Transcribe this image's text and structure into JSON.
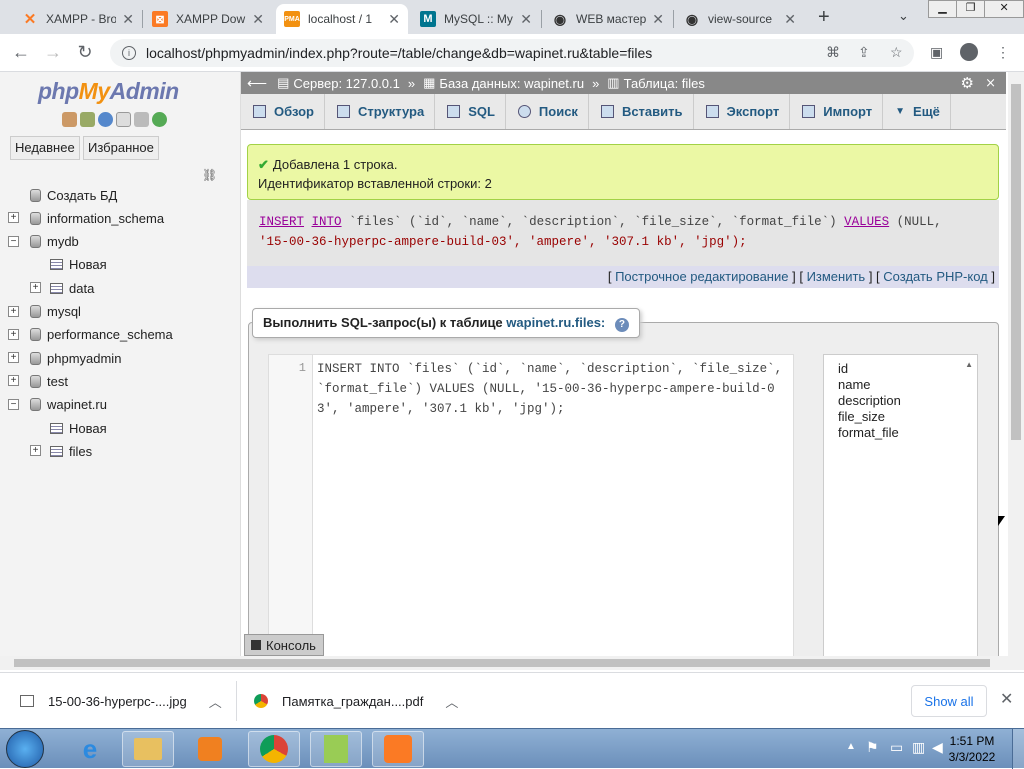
{
  "browser": {
    "tabs": [
      {
        "title": "XAMPP - Bro",
        "icon": "xampp-icon",
        "color": "#fb7a24"
      },
      {
        "title": "XAMPP Dow",
        "icon": "xampp-icon",
        "color": "#fb7a24"
      },
      {
        "title": "localhost / 1",
        "icon": "phpmyadmin-icon",
        "color": "#f29111"
      },
      {
        "title": "MySQL :: My",
        "icon": "mysql-icon",
        "color": "#00758f"
      },
      {
        "title": "WEB мастер",
        "icon": "eye-icon",
        "color": "#333333"
      },
      {
        "title": "view-source",
        "icon": "eye-icon",
        "color": "#333333"
      }
    ],
    "url": "localhost/phpmyadmin/index.php?route=/table/change&db=wapinet.ru&table=files"
  },
  "sidebar": {
    "logo": {
      "php": "php",
      "my": "My",
      "admin": "Admin"
    },
    "tabs": [
      "Недавнее",
      "Избранное"
    ],
    "tree": [
      {
        "label": "Создать БД",
        "level": 0,
        "expander": "",
        "icon": "db"
      },
      {
        "label": "information_schema",
        "level": 0,
        "expander": "+",
        "icon": "db"
      },
      {
        "label": "mydb",
        "level": 0,
        "expander": "−",
        "icon": "db"
      },
      {
        "label": "Новая",
        "level": 1,
        "expander": "",
        "icon": "tbl"
      },
      {
        "label": "data",
        "level": 1,
        "expander": "+",
        "icon": "tbl"
      },
      {
        "label": "mysql",
        "level": 0,
        "expander": "+",
        "icon": "db"
      },
      {
        "label": "performance_schema",
        "level": 0,
        "expander": "+",
        "icon": "db"
      },
      {
        "label": "phpmyadmin",
        "level": 0,
        "expander": "+",
        "icon": "db"
      },
      {
        "label": "test",
        "level": 0,
        "expander": "+",
        "icon": "db"
      },
      {
        "label": "wapinet.ru",
        "level": 0,
        "expander": "−",
        "icon": "db"
      },
      {
        "label": "Новая",
        "level": 1,
        "expander": "",
        "icon": "tbl"
      },
      {
        "label": "files",
        "level": 1,
        "expander": "+",
        "icon": "tbl"
      }
    ]
  },
  "breadcrumb": {
    "server": "Сервер: 127.0.0.1",
    "database": "База данных: wapinet.ru",
    "table": "Таблица: files"
  },
  "menu": [
    "Обзор",
    "Структура",
    "SQL",
    "Поиск",
    "Вставить",
    "Экспорт",
    "Импорт",
    "Ещё"
  ],
  "message": {
    "line1": "Добавлена 1 строка.",
    "line2": "Идентификатор вставленной строки: 2"
  },
  "query": {
    "kw1": "INSERT",
    "kw2": "INTO",
    "part1": " `files` (`id`, `name`, `description`, `file_size`, `format_file`) ",
    "kw3": "VALUES",
    "part2": " (NULL,",
    "line2": "'15-00-36-hyperpc-ampere-build-03', 'ampere', '307.1 kb', 'jpg');"
  },
  "query_links": {
    "open": "[",
    "inline": "Построчное редактирование",
    "sep1": "] [",
    "edit": "Изменить",
    "sep2": "] [",
    "php": "Создать PHP-код",
    "close": "]"
  },
  "sql_panel": {
    "legend_prefix": "Выполнить SQL-запрос(ы) к таблице",
    "legend_table": "wapinet.ru.files:",
    "line_number": "1",
    "code": "INSERT INTO `files` (`id`, `name`, `description`, `file_size`, `format_file`) VALUES (NULL, '15-00-36-hyperpc-ampere-build-03', 'ampere', '307.1 kb', 'jpg');",
    "columns": [
      "id",
      "name",
      "description",
      "file_size",
      "format_file"
    ]
  },
  "console_label": "Консоль",
  "downloads": {
    "items": [
      "15-00-36-hyperpc-....jpg",
      "Памятка_граждан....pdf"
    ],
    "show_all": "Show all"
  },
  "taskbar": {
    "time": "1:51 PM",
    "date": "3/3/2022"
  }
}
